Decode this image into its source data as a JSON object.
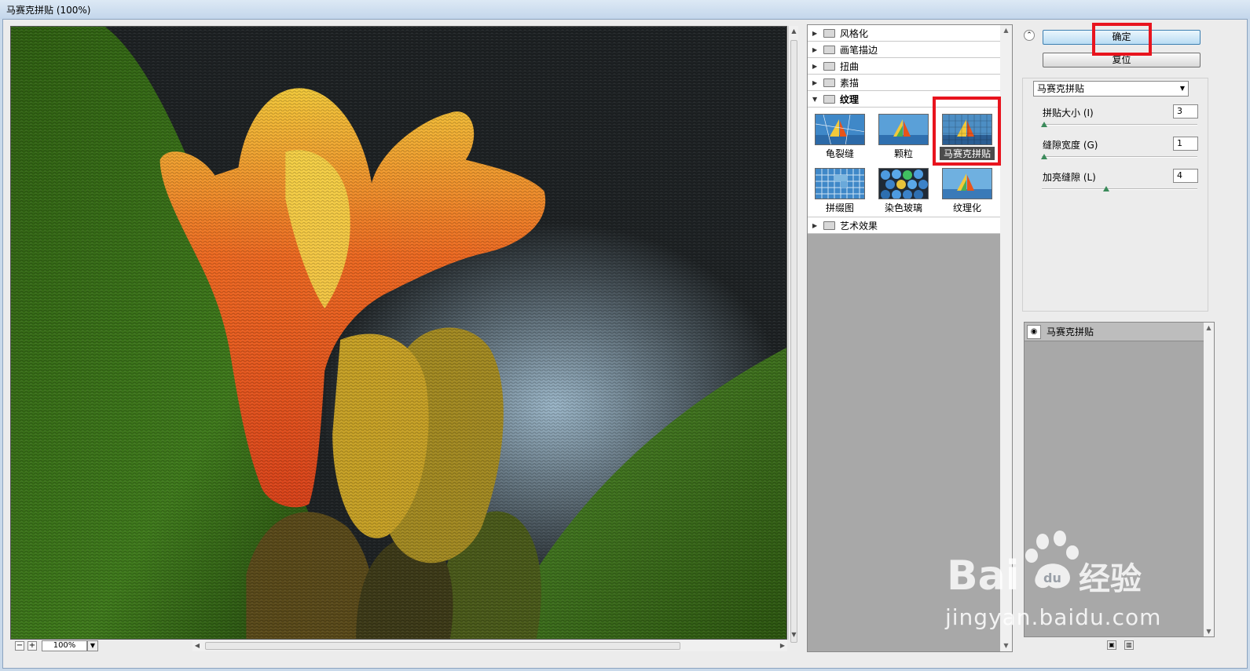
{
  "window": {
    "title": "马赛克拼贴 (100%)"
  },
  "preview": {
    "zoom": "100%",
    "zoom_out": "−",
    "zoom_in": "+"
  },
  "filter_tree": {
    "categories": [
      {
        "label": "风格化",
        "expanded": false
      },
      {
        "label": "画笔描边",
        "expanded": false
      },
      {
        "label": "扭曲",
        "expanded": false
      },
      {
        "label": "素描",
        "expanded": false
      },
      {
        "label": "纹理",
        "expanded": true
      },
      {
        "label": "艺术效果",
        "expanded": false
      }
    ],
    "texture_filters": [
      "龟裂缝",
      "颗粒",
      "马赛克拼贴",
      "拼缀图",
      "染色玻璃",
      "纹理化"
    ],
    "selected_filter": "马赛克拼贴"
  },
  "actions": {
    "ok_label": "确定",
    "reset_label": "复位"
  },
  "settings": {
    "filter_select": "马赛克拼贴",
    "params": [
      {
        "label": "拼贴大小 (I)",
        "value": "3",
        "slider_fraction": 0.0
      },
      {
        "label": "缝隙宽度 (G)",
        "value": "1",
        "slider_fraction": 0.0
      },
      {
        "label": "加亮缝隙 (L)",
        "value": "4",
        "slider_fraction": 0.4
      }
    ]
  },
  "layers": {
    "items": [
      {
        "label": "马赛克拼贴",
        "visible": true
      }
    ]
  },
  "watermark": {
    "logo_text": "Baidu经验",
    "url": "jingyan.baidu.com"
  },
  "colors": {
    "highlight_box": "#e8141e",
    "flower_orange": "#e8541a",
    "leaf_green": "#3f7a1c"
  }
}
